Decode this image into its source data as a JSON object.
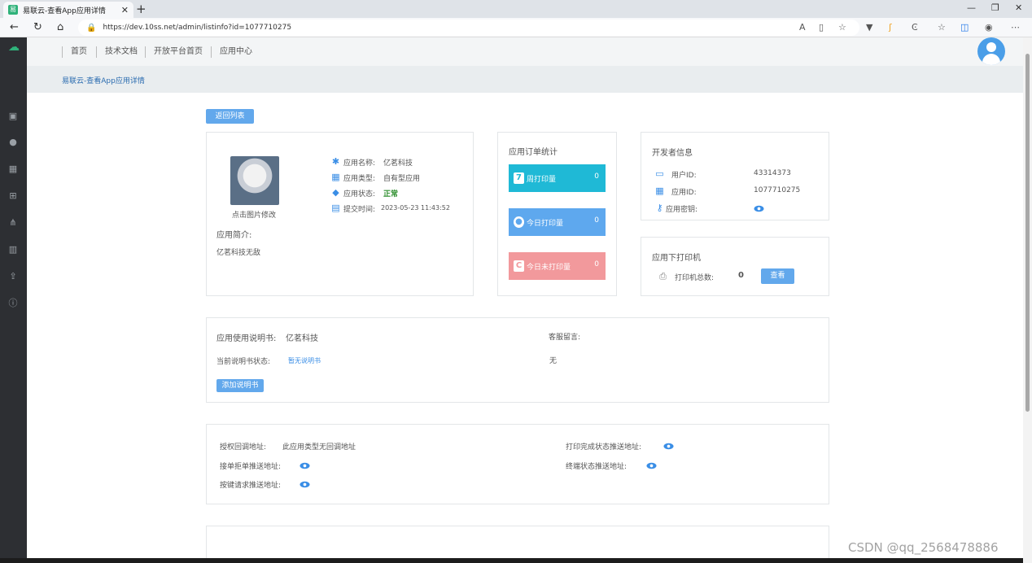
{
  "browser": {
    "tab_title": "易联云-查看App应用详情",
    "url": "https://dev.10ss.net/admin/listinfo?id=1077710275"
  },
  "topnav": {
    "items": [
      "首页",
      "技术文档",
      "开放平台首页",
      "应用中心"
    ]
  },
  "breadcrumb": "易联云-查看App应用详情",
  "back_button": "返回列表",
  "app_info": {
    "photo_caption": "点击图片修改",
    "name_label": "应用名称:",
    "name": "亿茗科技",
    "type_label": "应用类型:",
    "type": "自有型应用",
    "status_label": "应用状态:",
    "status": "正常",
    "time_label": "提交时间:",
    "time": "2023-05-23 11:43:52",
    "intro_label": "应用简介:",
    "intro": "亿茗科技无敌"
  },
  "order_stats": {
    "title": "应用订单统计",
    "items": [
      {
        "icon": "7",
        "label": "周打印量",
        "value": "0",
        "color": "#1fb9d6"
      },
      {
        "icon": "●",
        "label": "今日打印量",
        "value": "0",
        "color": "#5ea8ee"
      },
      {
        "icon": "C",
        "label": "今日未打印量",
        "value": "0",
        "color": "#f2999c"
      }
    ]
  },
  "developer": {
    "title": "开发者信息",
    "user_label": "用户ID:",
    "user_id": "43314373",
    "app_label": "应用ID:",
    "app_id": "1077710275",
    "key_label": "应用密钥:"
  },
  "printers": {
    "title": "应用下打印机",
    "total_label": "打印机总数:",
    "total": "0",
    "view_button": "查看"
  },
  "manual": {
    "label": "应用使用说明书:",
    "name": "亿茗科技",
    "status_label": "当前说明书状态:",
    "status": "暂无说明书",
    "add_button": "添加说明书",
    "cs_label": "客服留言:",
    "cs_value": "无"
  },
  "callbacks": {
    "auth_label": "授权回调地址:",
    "auth_value": "此应用类型无回调地址",
    "order_label": "接单拒单推送地址:",
    "key_label": "按键请求推送地址:",
    "print_label": "打印完成状态推送地址:",
    "terminal_label": "终端状态推送地址:"
  },
  "watermark": "CSDN @qq_2568478886"
}
